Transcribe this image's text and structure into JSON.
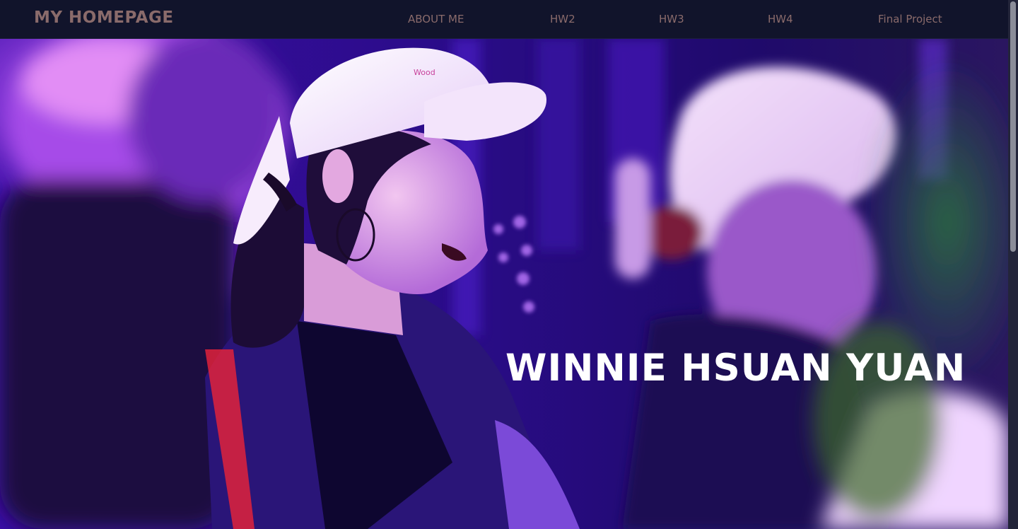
{
  "nav": {
    "brand": "MY HOMEPAGE",
    "links": [
      "ABOUT ME",
      "HW2",
      "HW3",
      "HW4",
      "Final Project"
    ]
  },
  "hero": {
    "title": "WINNIE HSUAN YUAN",
    "photo_description": "concert crowd photo with purple lighting"
  },
  "colors": {
    "navbar_bg": "#11142b",
    "nav_text": "#8a6b6b",
    "hero_title": "#ffffff",
    "hero_tint": "#5b16d6"
  }
}
